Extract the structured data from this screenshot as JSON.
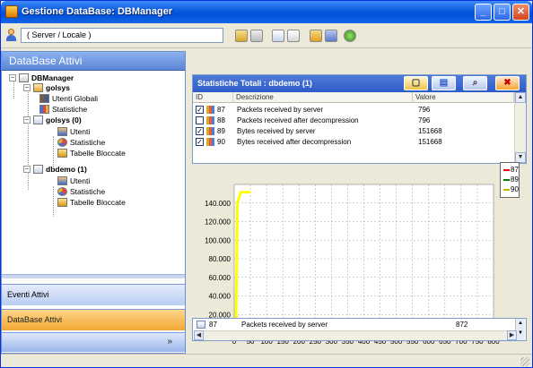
{
  "window": {
    "title": "Gestione DataBase: DBManager"
  },
  "toolbar": {
    "server_label": "( Server / Locale )"
  },
  "nav": {
    "header": "DataBase Attivi",
    "tree": {
      "root": "DBManager",
      "server": "golsys",
      "utenti_globali": "Utenti Globali",
      "statistiche": "Statistiche",
      "db1": "golsys (0)",
      "db1_utenti": "Utenti",
      "db1_statistiche": "Statistiche",
      "db1_tabelle": "Tabelle Bloccate",
      "db2": "dbdemo (1)",
      "db2_utenti": "Utenti",
      "db2_statistiche": "Statistiche",
      "db2_tabelle": "Tabelle Bloccate"
    },
    "buttons": {
      "eventi": "Eventi Attivi",
      "database": "DataBase Attivi"
    }
  },
  "stats": {
    "title": "Statistiche Totali :  dbdemo (1)",
    "columns": [
      "ID",
      "Descrizione",
      "Valore"
    ],
    "rows": [
      {
        "id": "87",
        "checked": true,
        "desc": "Packets received by server",
        "value": "796"
      },
      {
        "id": "88",
        "checked": false,
        "desc": "Packets received after decompression",
        "value": "796"
      },
      {
        "id": "89",
        "checked": true,
        "desc": "Bytes received by server",
        "value": "151668"
      },
      {
        "id": "90",
        "checked": true,
        "desc": "Bytes received after decompression",
        "value": "151668"
      }
    ]
  },
  "chart_data": {
    "type": "line",
    "title": "",
    "xlabel": "",
    "ylabel": "",
    "x_ticks": [
      "0",
      "50",
      "100",
      "150",
      "200",
      "250",
      "300",
      "350",
      "400",
      "450",
      "500",
      "550",
      "600",
      "650",
      "700",
      "750",
      "800"
    ],
    "y_ticks": [
      "0",
      "20.000",
      "40.000",
      "60.000",
      "80.000",
      "100.000",
      "120.000",
      "140.000"
    ],
    "xlim": [
      0,
      800
    ],
    "ylim": [
      0,
      160000
    ],
    "legend_position": "top-right",
    "series": [
      {
        "name": "87",
        "color": "#ff0000",
        "x": [
          5,
          10,
          50
        ],
        "y": [
          0,
          796,
          796
        ]
      },
      {
        "name": "89",
        "color": "#008000",
        "x": [
          5,
          10,
          20,
          50
        ],
        "y": [
          0,
          140000,
          151668,
          151668
        ]
      },
      {
        "name": "90",
        "color": "#ffff00",
        "x": [
          5,
          10,
          20,
          50
        ],
        "y": [
          0,
          140000,
          151668,
          151668
        ]
      }
    ]
  },
  "status": {
    "id": "87",
    "desc": "Packets received by server",
    "value": "872"
  }
}
